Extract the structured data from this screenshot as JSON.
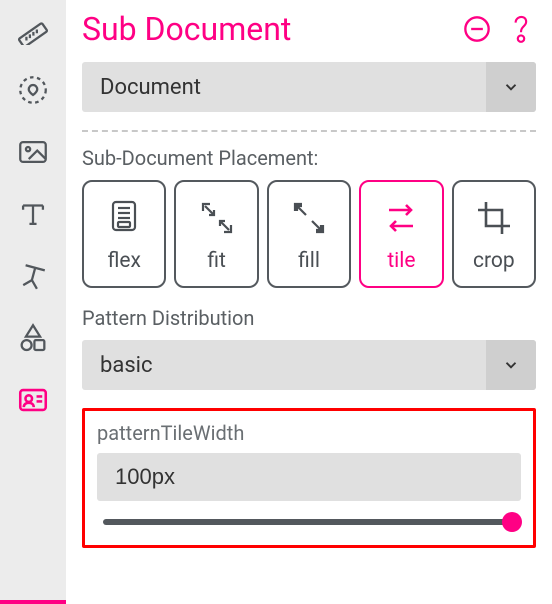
{
  "header": {
    "title": "Sub Document"
  },
  "document_select": {
    "value": "Document"
  },
  "placement": {
    "label": "Sub-Document Placement:",
    "items": [
      {
        "key": "flex",
        "label": "flex",
        "active": false
      },
      {
        "key": "fit",
        "label": "fit",
        "active": false
      },
      {
        "key": "fill",
        "label": "fill",
        "active": false
      },
      {
        "key": "tile",
        "label": "tile",
        "active": true
      },
      {
        "key": "crop",
        "label": "crop",
        "active": false
      }
    ]
  },
  "distribution": {
    "label": "Pattern Distribution",
    "value": "basic"
  },
  "tileWidth": {
    "label": "patternTileWidth",
    "value": "100px",
    "sliderPosition": 100
  },
  "sidebar": {
    "items": [
      {
        "key": "ruler",
        "name": "ruler-icon"
      },
      {
        "key": "badge",
        "name": "badge-icon"
      },
      {
        "key": "image",
        "name": "image-icon"
      },
      {
        "key": "text",
        "name": "text-icon"
      },
      {
        "key": "pin",
        "name": "pin-icon"
      },
      {
        "key": "shapes",
        "name": "shapes-icon"
      },
      {
        "key": "card",
        "name": "id-card-icon"
      }
    ],
    "activeKey": "card"
  }
}
